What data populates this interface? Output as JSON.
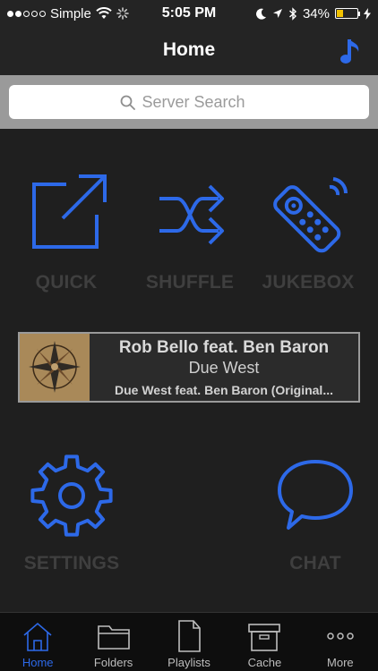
{
  "status_bar": {
    "carrier": "Simple",
    "time": "5:05 PM",
    "battery_percent": "34%",
    "battery_level": 0.34,
    "signal_bars": 2,
    "signal_total": 5
  },
  "nav": {
    "title": "Home",
    "right_icon": "music-note-icon"
  },
  "search": {
    "placeholder": "Server Search"
  },
  "tiles": {
    "quick": "QUICK",
    "shuffle": "SHUFFLE",
    "jukebox": "JUKEBOX",
    "settings": "SETTINGS",
    "chat": "CHAT"
  },
  "now_playing": {
    "artist": "Rob Bello feat. Ben Baron",
    "album": "Due West",
    "track": "Due West feat. Ben Baron (Original..."
  },
  "tab_bar": {
    "items": [
      {
        "label": "Home",
        "icon": "home-icon",
        "active": true
      },
      {
        "label": "Folders",
        "icon": "folder-icon",
        "active": false
      },
      {
        "label": "Playlists",
        "icon": "document-icon",
        "active": false
      },
      {
        "label": "Cache",
        "icon": "archive-box-icon",
        "active": false
      },
      {
        "label": "More",
        "icon": "more-dots-icon",
        "active": false
      }
    ]
  },
  "colors": {
    "accent": "#2d69e8",
    "tile_label": "#3f3f3f",
    "background": "#1f1f1f"
  }
}
